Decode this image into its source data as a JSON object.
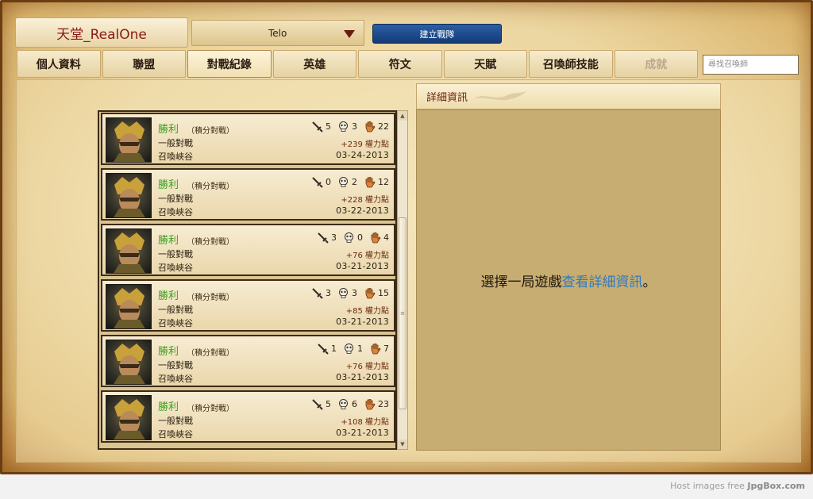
{
  "header": {
    "summoner_name": "天堂_RealOne",
    "champion_filter": "Telo",
    "create_team_label": "建立戰隊"
  },
  "tabs": [
    {
      "label": "個人資料",
      "state": "normal"
    },
    {
      "label": "聯盟",
      "state": "normal"
    },
    {
      "label": "對戰紀錄",
      "state": "active"
    },
    {
      "label": "英雄",
      "state": "normal"
    },
    {
      "label": "符文",
      "state": "normal"
    },
    {
      "label": "天賦",
      "state": "normal"
    },
    {
      "label": "召喚師技能",
      "state": "normal"
    },
    {
      "label": "成就",
      "state": "disabled"
    }
  ],
  "search": {
    "placeholder": "尋找召喚師"
  },
  "matches": [
    {
      "result": "勝利",
      "queue": "（積分對戰）",
      "mode": "一般對戰",
      "map": "召喚峽谷",
      "kills": "5",
      "deaths": "3",
      "assists": "22",
      "ip": "+239 權力點",
      "date": "03-24-2013"
    },
    {
      "result": "勝利",
      "queue": "（積分對戰）",
      "mode": "一般對戰",
      "map": "召喚峽谷",
      "kills": "0",
      "deaths": "2",
      "assists": "12",
      "ip": "+228 權力點",
      "date": "03-22-2013"
    },
    {
      "result": "勝利",
      "queue": "（積分對戰）",
      "mode": "一般對戰",
      "map": "召喚峽谷",
      "kills": "3",
      "deaths": "0",
      "assists": "4",
      "ip": "+76 權力點",
      "date": "03-21-2013"
    },
    {
      "result": "勝利",
      "queue": "（積分對戰）",
      "mode": "一般對戰",
      "map": "召喚峽谷",
      "kills": "3",
      "deaths": "3",
      "assists": "15",
      "ip": "+85 權力點",
      "date": "03-21-2013"
    },
    {
      "result": "勝利",
      "queue": "（積分對戰）",
      "mode": "一般對戰",
      "map": "召喚峽谷",
      "kills": "1",
      "deaths": "1",
      "assists": "7",
      "ip": "+76 權力點",
      "date": "03-21-2013"
    },
    {
      "result": "勝利",
      "queue": "（積分對戰）",
      "mode": "一般對戰",
      "map": "召喚峽谷",
      "kills": "5",
      "deaths": "6",
      "assists": "23",
      "ip": "+108 權力點",
      "date": "03-21-2013"
    }
  ],
  "detail": {
    "title": "詳細資訊",
    "prompt_before": "選擇一局遊戲",
    "prompt_link": "查看詳細資訊",
    "prompt_after": "。"
  },
  "watermark": {
    "prefix": "Host images free",
    "brand": "JpgBox.com"
  },
  "icons": {
    "kills": "sword-icon",
    "deaths": "skull-icon",
    "assists": "hand-icon"
  },
  "colors": {
    "win": "#3e9f22",
    "link": "#2d7bc6",
    "title_red": "#8a1a12"
  }
}
